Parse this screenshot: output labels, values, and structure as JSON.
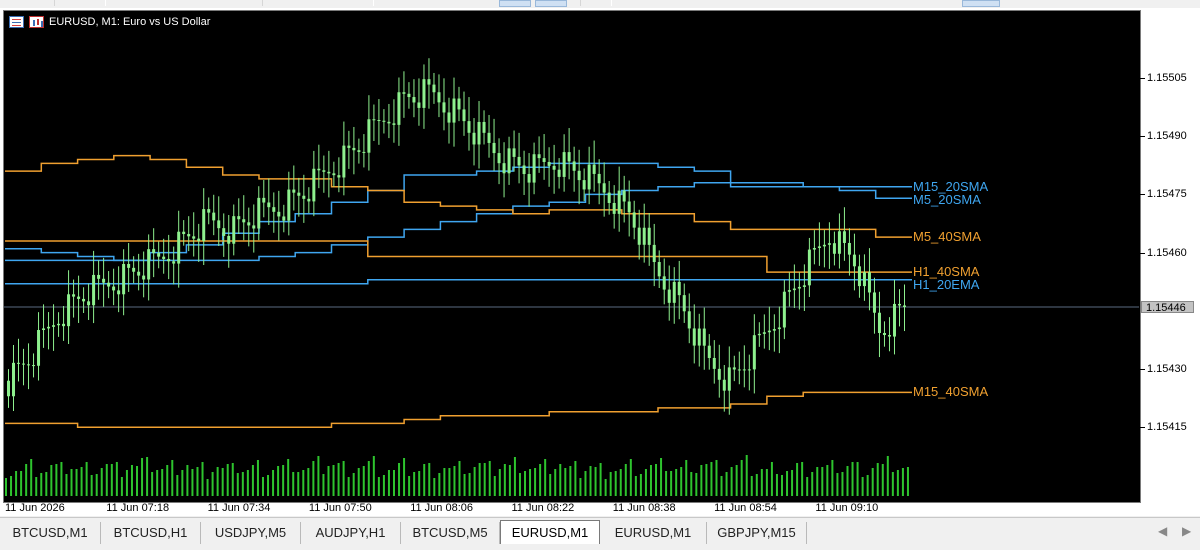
{
  "chart_header": {
    "title": "EURUSD, M1:  Euro vs US Dollar",
    "icons": [
      "list-icon",
      "bar-chart-icon"
    ]
  },
  "price_axis": {
    "ticks": [
      "1.15505",
      "1.15490",
      "1.15475",
      "1.15460",
      "1.15446",
      "1.15430",
      "1.15415"
    ],
    "current_price": "1.15446"
  },
  "time_axis": {
    "ticks": [
      "11 Jun 2026",
      "11 Jun 07:18",
      "11 Jun 07:34",
      "11 Jun 07:50",
      "11 Jun 08:06",
      "11 Jun 08:22",
      "11 Jun 08:38",
      "11 Jun 08:54",
      "11 Jun 09:10"
    ]
  },
  "indicators": [
    {
      "name": "M15_20SMA",
      "color": "#3fa6f0"
    },
    {
      "name": "M5_20SMA",
      "color": "#3fa6f0"
    },
    {
      "name": "M5_40SMA",
      "color": "#f0a030"
    },
    {
      "name": "H1_40SMA",
      "color": "#f0a030"
    },
    {
      "name": "H1_20EMA",
      "color": "#3fa6f0"
    },
    {
      "name": "M15_40SMA",
      "color": "#f0a030"
    }
  ],
  "tabs": [
    "BTCUSD,M1",
    "BTCUSD,H1",
    "USDJPY,M5",
    "AUDJPY,H1",
    "BTCUSD,M5",
    "EURUSD,M1",
    "EURUSD,M1",
    "GBPJPY,M15"
  ],
  "active_tab": "EURUSD,M1",
  "colors": {
    "background": "#000000",
    "bull_candle": "#8ef08e",
    "volume": "#2ec42e",
    "grid_line": "#5a6a80"
  },
  "chart_data": {
    "type": "candlestick",
    "symbol": "EURUSD",
    "timeframe": "M1",
    "ylim": [
      1.15404,
      1.15522
    ],
    "x_start": "11 Jun 2026",
    "series": [
      {
        "name": "M15_20SMA",
        "values": [
          1.15458,
          1.15458,
          1.15458,
          1.15458,
          1.1546,
          1.15462,
          1.15465,
          1.15468,
          1.1547,
          1.15473,
          1.15476,
          1.1548,
          1.1548,
          1.15481,
          1.15482,
          1.15483,
          1.15483,
          1.15483,
          1.15482,
          1.15481,
          1.15477,
          1.15477,
          1.15477,
          1.15477,
          1.15477
        ]
      },
      {
        "name": "M5_20SMA",
        "values": [
          1.15461,
          1.1546,
          1.15459,
          1.15458,
          1.15458,
          1.15458,
          1.15458,
          1.15459,
          1.1546,
          1.15462,
          1.15464,
          1.15466,
          1.15468,
          1.1547,
          1.15472,
          1.15473,
          1.15475,
          1.15476,
          1.15477,
          1.15478,
          1.15478,
          1.15478,
          1.15477,
          1.15476,
          1.15474
        ]
      },
      {
        "name": "M5_40SMA",
        "values": [
          1.15481,
          1.15483,
          1.15484,
          1.15485,
          1.15484,
          1.15482,
          1.1548,
          1.15479,
          1.15479,
          1.15477,
          1.15476,
          1.15473,
          1.15472,
          1.15471,
          1.1547,
          1.15471,
          1.15471,
          1.1547,
          1.1547,
          1.15468,
          1.15466,
          1.15466,
          1.15466,
          1.15466,
          1.15464
        ]
      },
      {
        "name": "H1_40SMA",
        "values": [
          1.15463,
          1.15463,
          1.15463,
          1.15463,
          1.15463,
          1.15463,
          1.15463,
          1.15463,
          1.15463,
          1.15463,
          1.15459,
          1.15459,
          1.15459,
          1.15459,
          1.15459,
          1.15459,
          1.15459,
          1.15459,
          1.15459,
          1.15459,
          1.15459,
          1.15455,
          1.15455,
          1.15455,
          1.15455
        ]
      },
      {
        "name": "H1_20EMA",
        "values": [
          1.15452,
          1.15452,
          1.15452,
          1.15452,
          1.15452,
          1.15452,
          1.15452,
          1.15452,
          1.15452,
          1.15452,
          1.15453,
          1.15453,
          1.15453,
          1.15453,
          1.15453,
          1.15453,
          1.15453,
          1.15453,
          1.15453,
          1.15453,
          1.15453,
          1.15453,
          1.15453,
          1.15453,
          1.15453
        ]
      },
      {
        "name": "M15_40SMA",
        "values": [
          1.15416,
          1.15416,
          1.15415,
          1.15415,
          1.15415,
          1.15415,
          1.15415,
          1.15415,
          1.15415,
          1.15416,
          1.15416,
          1.15417,
          1.15418,
          1.15418,
          1.15418,
          1.15419,
          1.15419,
          1.15419,
          1.1542,
          1.1542,
          1.15421,
          1.15423,
          1.15424,
          1.15424,
          1.15424
        ]
      }
    ],
    "price": [
      1.15427,
      1.15434,
      1.15444,
      1.15449,
      1.15452,
      1.15455,
      1.15458,
      1.15463,
      1.15468,
      1.15466,
      1.1547,
      1.15472,
      1.15476,
      1.15482,
      1.15487,
      1.15494,
      1.155,
      1.15501,
      1.15496,
      1.15489,
      1.15484,
      1.15481,
      1.15484,
      1.1548,
      1.15476,
      1.1547,
      1.15456,
      1.15447,
      1.15433,
      1.15427,
      1.15435,
      1.15445,
      1.15455,
      1.15465,
      1.15458,
      1.1544,
      1.15446
    ],
    "volume": [
      26,
      25,
      27,
      24,
      28,
      30,
      26,
      27,
      25,
      29,
      27,
      26,
      28,
      30,
      27,
      26,
      28,
      29,
      27,
      30,
      31,
      28,
      27,
      26,
      30,
      32,
      28,
      33,
      31,
      30,
      29,
      27,
      28,
      30,
      29,
      31,
      33
    ]
  }
}
